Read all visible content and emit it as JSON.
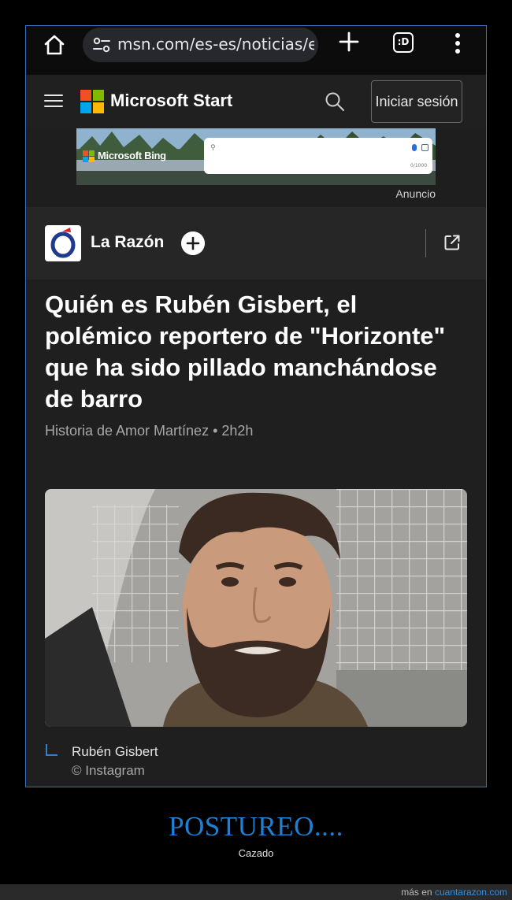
{
  "browser": {
    "url": "msn.com/es-es/noticias/es",
    "tabs_label": ":D"
  },
  "header": {
    "brand": "Microsoft Start",
    "signin_label": "Iniciar sesión"
  },
  "ad": {
    "bing_label": "Microsoft Bing",
    "counter": "0/1000",
    "label": "Anuncio"
  },
  "source": {
    "name": "La Razón"
  },
  "article": {
    "headline": "Quién es Rubén Gisbert, el polémico reportero de \"Horizonte\" que ha sido pillado manchándose de barro",
    "byline": "Historia de Amor Martínez • 2h2h",
    "caption": "Rubén Gisbert",
    "credit": "© Instagram"
  },
  "post": {
    "title": "POSTUREO....",
    "subtitle": "Cazado"
  },
  "footer": {
    "prefix": "más en",
    "site": "cuantarazon.com"
  },
  "colors": {
    "accent": "#1e7fd4",
    "frame_border": "#3b6fbf",
    "ms_red": "#f25022",
    "ms_green": "#7fba00",
    "ms_blue": "#00a4ef",
    "ms_yellow": "#ffb900"
  }
}
